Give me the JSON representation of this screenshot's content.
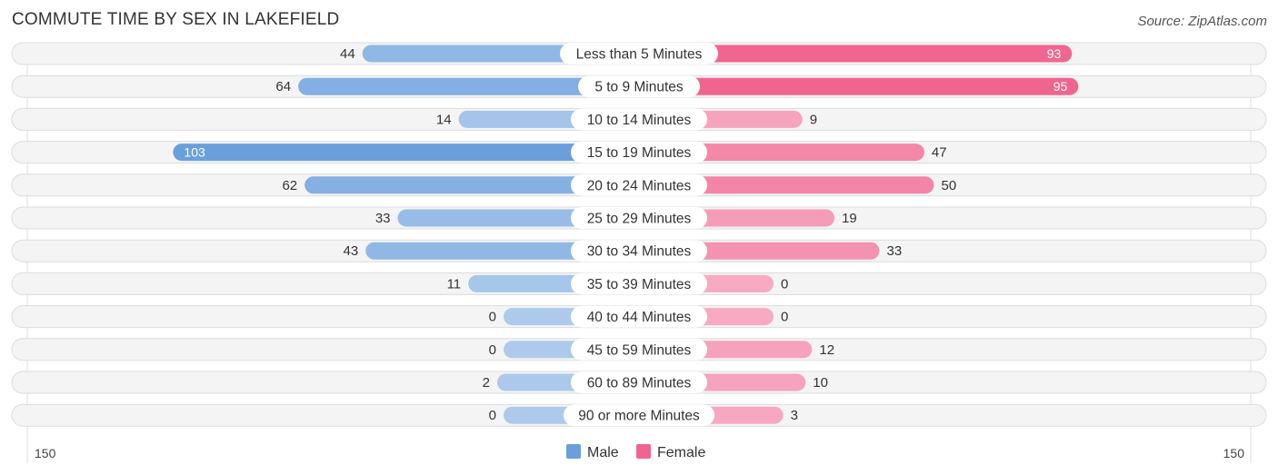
{
  "title": "COMMUTE TIME BY SEX IN LAKEFIELD",
  "source": "Source: ZipAtlas.com",
  "chart_data": {
    "type": "bar",
    "orientation": "horizontal-diverging",
    "title": "COMMUTE TIME BY SEX IN LAKEFIELD",
    "categories": [
      "Less than 5 Minutes",
      "5 to 9 Minutes",
      "10 to 14 Minutes",
      "15 to 19 Minutes",
      "20 to 24 Minutes",
      "25 to 29 Minutes",
      "30 to 34 Minutes",
      "35 to 39 Minutes",
      "40 to 44 Minutes",
      "45 to 59 Minutes",
      "60 to 89 Minutes",
      "90 or more Minutes"
    ],
    "series": [
      {
        "name": "Male",
        "color": "#6a9fdc",
        "values": [
          44,
          64,
          14,
          103,
          62,
          33,
          43,
          11,
          0,
          0,
          2,
          0
        ]
      },
      {
        "name": "Female",
        "color": "#f06590",
        "values": [
          93,
          95,
          9,
          47,
          50,
          19,
          33,
          0,
          0,
          12,
          10,
          3
        ]
      }
    ],
    "axis_left_label": "150",
    "axis_right_label": "150",
    "xlim": [
      -150,
      150
    ],
    "legend_position": "bottom-center"
  }
}
